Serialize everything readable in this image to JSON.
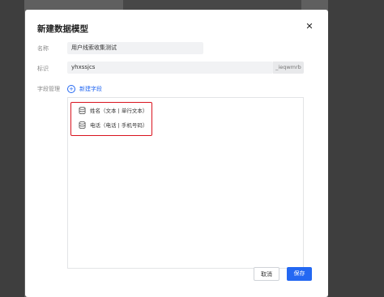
{
  "dialog": {
    "title": "新建数据模型",
    "close_icon": "close-icon"
  },
  "form": {
    "name_label": "名称",
    "name_value": "用户线索收集测试",
    "id_label": "标识",
    "id_value": "yhxssjcs",
    "id_suffix": "_ieqwmrb",
    "fields_label": "字段管理",
    "add_field_label": "新建字段"
  },
  "fields": [
    {
      "label": "姓名（文本 | 单行文本）",
      "icon": "database-icon"
    },
    {
      "label": "电话（电话 | 手机号码）",
      "icon": "database-icon"
    }
  ],
  "footer": {
    "cancel_label": "取消",
    "save_label": "保存"
  },
  "colors": {
    "accent": "#2468f2",
    "highlight_border": "#d9141f"
  }
}
